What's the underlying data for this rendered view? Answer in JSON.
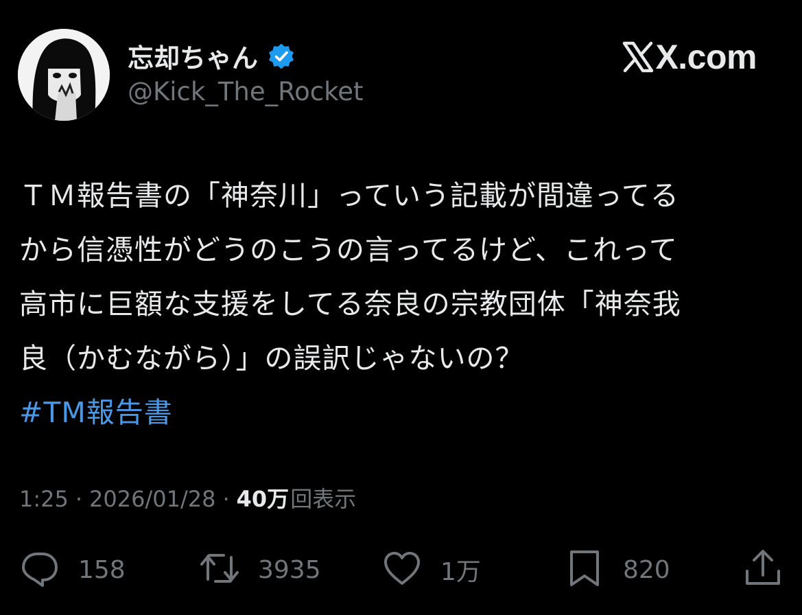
{
  "header": {
    "display_name": "忘却ちゃん",
    "handle": "@Kick_The_Rocket",
    "watermark": "X.com",
    "verified_color": "#1d9bf0"
  },
  "tweet": {
    "lines": [
      "ＴＭ報告書の「神奈川」っていう記載が間違ってる",
      "から信憑性がどうのこうの言ってるけど、これって",
      "高市に巨額な支援をしてる奈良の宗教団体「神奈我",
      "良（かむながら）」の誤訳じゃないの？"
    ],
    "hashtag": "#TM報告書"
  },
  "meta": {
    "time": "1:25",
    "date": "2026/01/28",
    "views_count": "40万",
    "views_label": "回表示"
  },
  "actions": {
    "reply_count": "158",
    "repost_count": "3935",
    "like_count": "1万",
    "bookmark_count": "820"
  },
  "colors": {
    "background": "#000000",
    "text": "#e7e9ea",
    "secondary": "#71767b",
    "link": "#4a99e9"
  }
}
